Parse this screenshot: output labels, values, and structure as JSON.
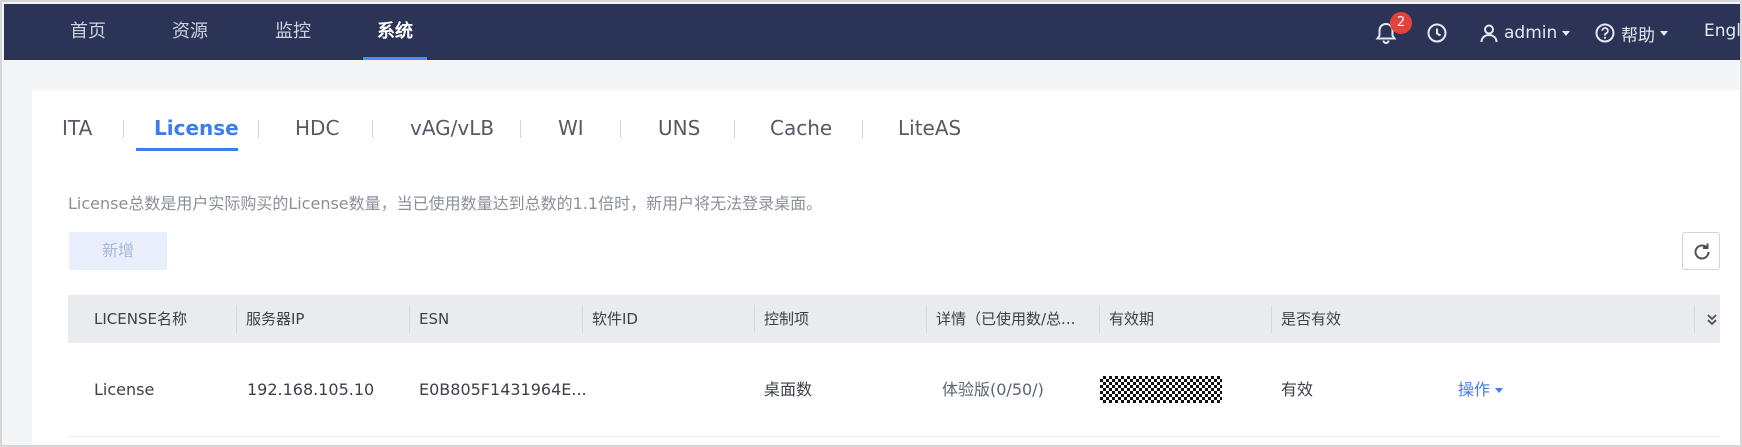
{
  "nav": {
    "items": [
      "首页",
      "资源",
      "监控",
      "系统"
    ],
    "notification_count": "2",
    "user": "admin",
    "help": "帮助",
    "language": "English"
  },
  "tabs": [
    "ITA",
    "License",
    "HDC",
    "vAG/vLB",
    "WI",
    "UNS",
    "Cache",
    "LiteAS"
  ],
  "active_tab": "License",
  "notice": "License总数是用户实际购买的License数量，当已使用数量达到总数的1.1倍时，新用户将无法登录桌面。",
  "toolbar": {
    "add_label": "新增"
  },
  "table": {
    "columns": [
      "LICENSE名称",
      "服务器IP",
      "ESN",
      "软件ID",
      "控制项",
      "详情（已使用数/总...",
      "有效期",
      "是否有效"
    ],
    "rows": [
      {
        "name": "License",
        "server_ip": "192.168.105.10",
        "esn": "E0B805F1431964E...",
        "software_id": "",
        "control": "桌面数",
        "detail": "体验版(0/50/)",
        "validity_period": "",
        "is_valid": "有效",
        "action": "操作"
      }
    ]
  },
  "colors": {
    "nav_bg": "#2b3356",
    "accent": "#3e7bf0",
    "badge": "#e5413b",
    "header_bg": "#e9ebee"
  }
}
